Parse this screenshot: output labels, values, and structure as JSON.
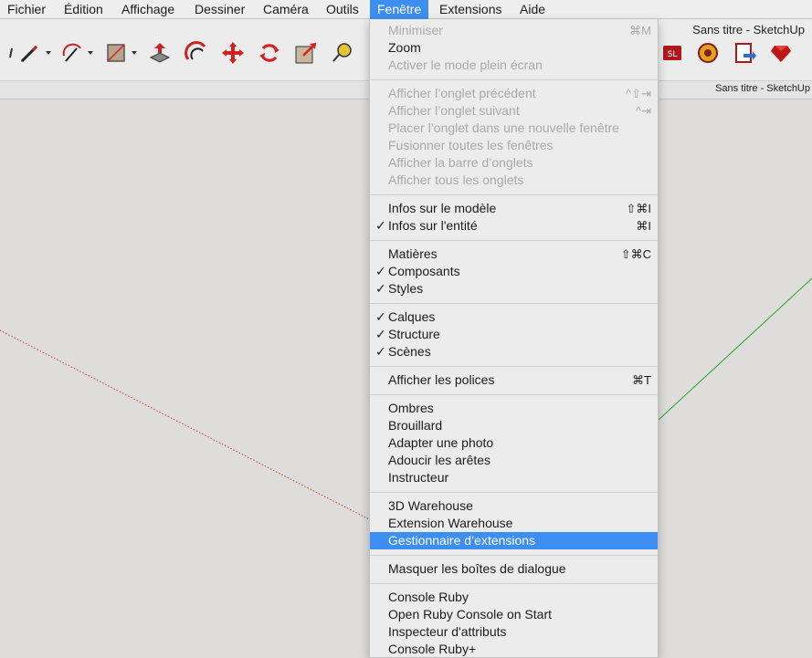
{
  "menubar": {
    "items": [
      "Fichier",
      "Édition",
      "Affichage",
      "Dessiner",
      "Caméra",
      "Outils",
      "Fenêtre",
      "Extensions",
      "Aide"
    ]
  },
  "window": {
    "title": "Sans titre - SketchUp",
    "tab_title": "Sans titre - SketchUp"
  },
  "toolbar": {
    "icons": [
      "pencil-icon",
      "arc-icon",
      "rectangle-icon",
      "push-pull-icon",
      "offset-icon",
      "move-icon",
      "rotate-icon",
      "scale-icon",
      "tape-measure-icon",
      "extension-icon-1",
      "extension-icon-2",
      "extension-icon-3",
      "ruby-icon"
    ]
  },
  "menu": {
    "title": "Fenêtre",
    "items": [
      {
        "label": "Minimiser",
        "shortcut": "⌘M",
        "disabled": true,
        "checked": false
      },
      {
        "label": "Zoom",
        "shortcut": "",
        "disabled": false,
        "checked": false
      },
      {
        "label": "Activer le mode plein écran",
        "shortcut": "",
        "disabled": true,
        "checked": false
      },
      {
        "label": "Afficher l’onglet précédent",
        "shortcut": "^⇧⇥",
        "disabled": true,
        "checked": false
      },
      {
        "label": "Afficher l’onglet suivant",
        "shortcut": "^⇥",
        "disabled": true,
        "checked": false
      },
      {
        "label": "Placer l’onglet dans une nouvelle fenêtre",
        "shortcut": "",
        "disabled": true,
        "checked": false
      },
      {
        "label": "Fusionner toutes les fenêtres",
        "shortcut": "",
        "disabled": true,
        "checked": false
      },
      {
        "label": "Afficher la barre d’onglets",
        "shortcut": "",
        "disabled": true,
        "checked": false
      },
      {
        "label": "Afficher tous les onglets",
        "shortcut": "",
        "disabled": true,
        "checked": false
      },
      {
        "label": "Infos sur le modèle",
        "shortcut": "⇧⌘I",
        "disabled": false,
        "checked": false
      },
      {
        "label": "Infos sur l'entité",
        "shortcut": "⌘I",
        "disabled": false,
        "checked": true
      },
      {
        "label": "Matières",
        "shortcut": "⇧⌘C",
        "disabled": false,
        "checked": false
      },
      {
        "label": "Composants",
        "shortcut": "",
        "disabled": false,
        "checked": true
      },
      {
        "label": "Styles",
        "shortcut": "",
        "disabled": false,
        "checked": true
      },
      {
        "label": "Calques",
        "shortcut": "",
        "disabled": false,
        "checked": true
      },
      {
        "label": "Structure",
        "shortcut": "",
        "disabled": false,
        "checked": true
      },
      {
        "label": "Scènes",
        "shortcut": "",
        "disabled": false,
        "checked": true
      },
      {
        "label": "Afficher les polices",
        "shortcut": "⌘T",
        "disabled": false,
        "checked": false
      },
      {
        "label": "Ombres",
        "shortcut": "",
        "disabled": false,
        "checked": false
      },
      {
        "label": "Brouillard",
        "shortcut": "",
        "disabled": false,
        "checked": false
      },
      {
        "label": "Adapter une photo",
        "shortcut": "",
        "disabled": false,
        "checked": false
      },
      {
        "label": "Adoucir les arêtes",
        "shortcut": "",
        "disabled": false,
        "checked": false
      },
      {
        "label": "Instructeur",
        "shortcut": "",
        "disabled": false,
        "checked": false
      },
      {
        "label": "3D Warehouse",
        "shortcut": "",
        "disabled": false,
        "checked": false
      },
      {
        "label": "Extension Warehouse",
        "shortcut": "",
        "disabled": false,
        "checked": false
      },
      {
        "label": "Gestionnaire d’extensions",
        "shortcut": "",
        "disabled": false,
        "checked": false,
        "highlighted": true
      },
      {
        "label": "Masquer les boîtes de dialogue",
        "shortcut": "",
        "disabled": false,
        "checked": false
      },
      {
        "label": "Console Ruby",
        "shortcut": "",
        "disabled": false,
        "checked": false
      },
      {
        "label": "Open Ruby Console on Start",
        "shortcut": "",
        "disabled": false,
        "checked": false
      },
      {
        "label": "Inspecteur d'attributs",
        "shortcut": "",
        "disabled": false,
        "checked": false
      },
      {
        "label": "Console Ruby+",
        "shortcut": "",
        "disabled": false,
        "checked": false
      }
    ],
    "check_glyph": "✓"
  },
  "colors": {
    "highlight": "#3d8ef2",
    "axis_red": "#c23b3b",
    "axis_green": "#1fa51f"
  }
}
